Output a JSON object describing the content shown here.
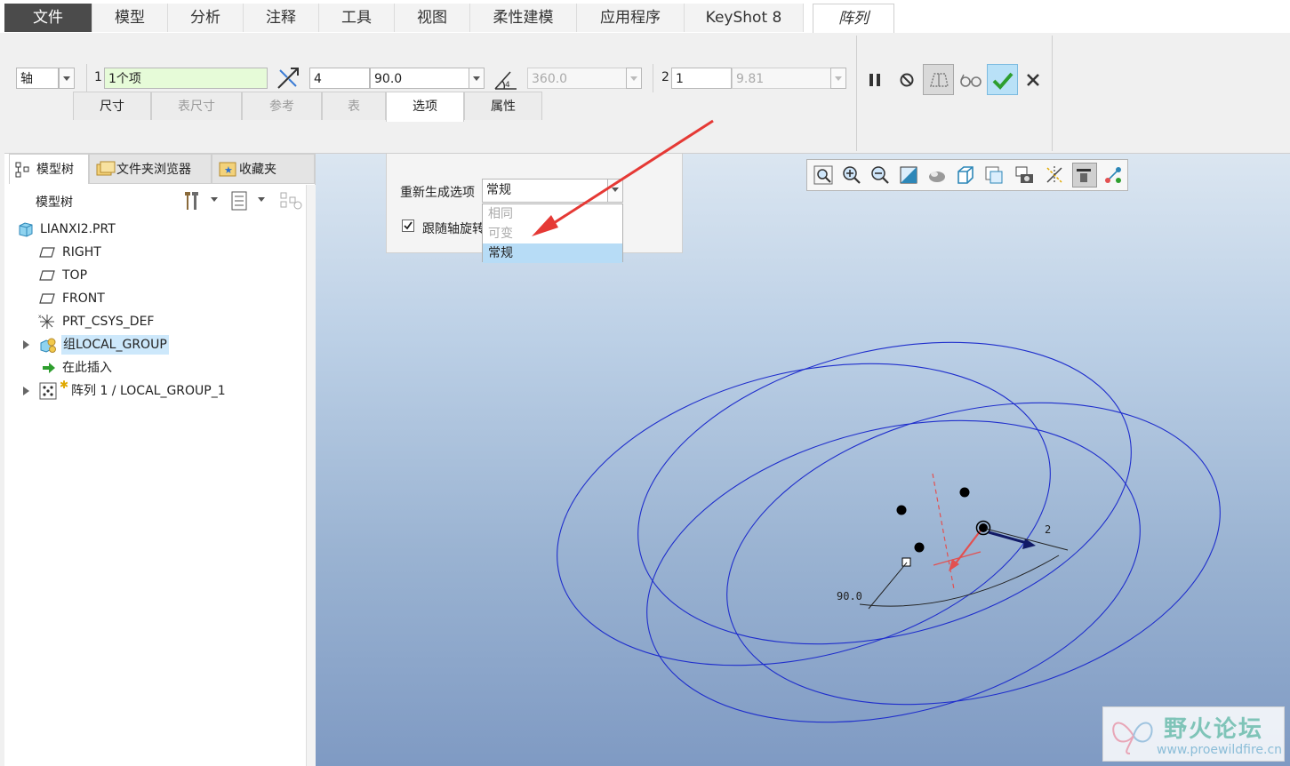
{
  "menu": {
    "tabs": [
      {
        "label": "文件"
      },
      {
        "label": "模型"
      },
      {
        "label": "分析"
      },
      {
        "label": "注释"
      },
      {
        "label": "工具"
      },
      {
        "label": "视图"
      },
      {
        "label": "柔性建模"
      },
      {
        "label": "应用程序"
      },
      {
        "label": "KeyShot 8"
      },
      {
        "label": "阵列"
      }
    ]
  },
  "ribbon": {
    "pattern_type": "轴",
    "dir1_index": "1",
    "dir1_members": "1个项",
    "dir1_count": "4",
    "dir1_angle": "90.0",
    "angle_extent": "360.0",
    "dir2_index": "2",
    "dir2_count": "1",
    "dir2_spacing": "9.81",
    "subtabs": [
      {
        "label": "尺寸",
        "enabled": true
      },
      {
        "label": "表尺寸",
        "enabled": false
      },
      {
        "label": "参考",
        "enabled": false
      },
      {
        "label": "表",
        "enabled": false
      },
      {
        "label": "选项",
        "enabled": true,
        "active": true
      },
      {
        "label": "属性",
        "enabled": true
      }
    ],
    "actions": [
      "pause-icon",
      "no-preview-icon",
      "feature-preview-icon",
      "glasses-icon",
      "confirm-check-icon",
      "cancel-x-icon"
    ]
  },
  "panel": {
    "tabs": [
      {
        "label": "模型树"
      },
      {
        "label": "文件夹浏览器"
      },
      {
        "label": "收藏夹"
      }
    ],
    "tree_header": "模型树",
    "tree": [
      {
        "label": "LIANXI2.PRT",
        "icon": "part-icon"
      },
      {
        "label": "RIGHT",
        "icon": "datum-plane-icon"
      },
      {
        "label": "TOP",
        "icon": "datum-plane-icon"
      },
      {
        "label": "FRONT",
        "icon": "datum-plane-icon"
      },
      {
        "label": "PRT_CSYS_DEF",
        "icon": "csys-icon"
      },
      {
        "label": "组LOCAL_GROUP",
        "icon": "group-icon",
        "selected": true
      },
      {
        "label": "在此插入",
        "icon": "insert-arrow-icon"
      },
      {
        "label": "阵列 1 / LOCAL_GROUP_1",
        "icon": "pattern-icon"
      }
    ]
  },
  "options": {
    "regen_label": "重新生成选项",
    "regen_value": "常规",
    "follow_axis_label": "跟随轴旋转",
    "follow_axis_checked": true,
    "dropdown": [
      {
        "label": "相同",
        "enabled": false
      },
      {
        "label": "可变",
        "enabled": false
      },
      {
        "label": "常规",
        "enabled": true,
        "selected": true
      }
    ]
  },
  "viewport": {
    "dim_angle": "90.0",
    "dim_dir2": "2",
    "curve_color": "#1f2ecc",
    "accent_red": "#e53935"
  },
  "watermark": {
    "title": "野火论坛",
    "url": "www.proewildfire.cn"
  }
}
